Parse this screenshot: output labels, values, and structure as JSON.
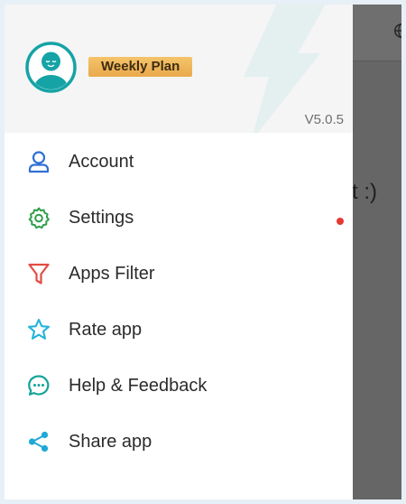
{
  "background_screen": {
    "partial_text": "rt :)"
  },
  "drawer": {
    "header": {
      "plan_badge": "Weekly Plan",
      "version": "V5.0.5"
    },
    "menu": [
      {
        "label": "Account",
        "icon": "user-icon",
        "color": "#2f6fd6"
      },
      {
        "label": "Settings",
        "icon": "gear-icon",
        "color": "#2e9e4a",
        "has_notification_dot": true
      },
      {
        "label": "Apps Filter",
        "icon": "funnel-icon",
        "color": "#e14c43"
      },
      {
        "label": "Rate app",
        "icon": "star-icon",
        "color": "#25b3d9"
      },
      {
        "label": "Help & Feedback",
        "icon": "chat-bubble-icon",
        "color": "#13a39a"
      },
      {
        "label": "Share app",
        "icon": "share-icon",
        "color": "#1ea9d6"
      }
    ]
  },
  "colors": {
    "accent_teal": "#15a3a6",
    "badge_gold": "#f0b75a",
    "notification_red": "#e53935",
    "overlay_gray": "#666666"
  }
}
